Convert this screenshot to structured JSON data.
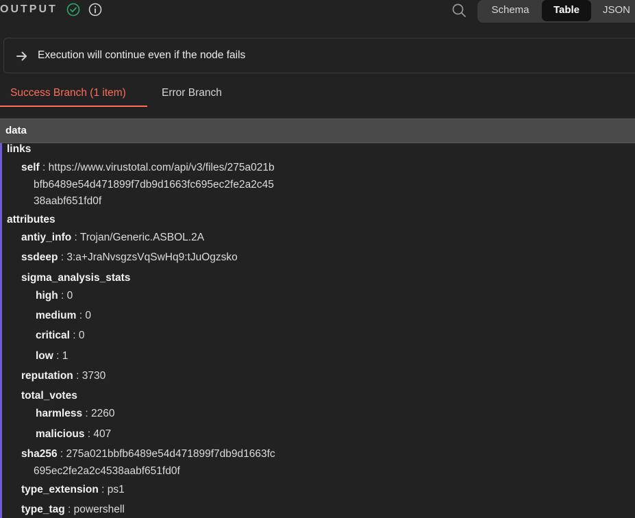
{
  "header": {
    "title": "OUTPUT",
    "views": [
      "Schema",
      "Table",
      "JSON"
    ],
    "active_view": "Table"
  },
  "notice": {
    "text": "Execution will continue even if the node fails"
  },
  "tabs": [
    "Success Branch (1 item)",
    "Error Branch"
  ],
  "table": {
    "column": "data"
  },
  "tree": {
    "links_key": "links",
    "self_key": "self",
    "self_val_1": "https://www.virustotal.com/api/v3/files/275a021b",
    "self_val_2": "bfb6489e54d471899f7db9d1663fc695ec2fe2a2c45",
    "self_val_3": "38aabf651fd0f",
    "attributes_key": "attributes",
    "antiy_info_key": "antiy_info",
    "antiy_info_val": "Trojan/Generic.ASBOL.2A",
    "ssdeep_key": "ssdeep",
    "ssdeep_val": "3:a+JraNvsgzsVqSwHq9:tJuOgzsko",
    "sigma_key": "sigma_analysis_stats",
    "high_key": "high",
    "high_val": "0",
    "medium_key": "medium",
    "medium_val": "0",
    "critical_key": "critical",
    "critical_val": "0",
    "low_key": "low",
    "low_val": "1",
    "reputation_key": "reputation",
    "reputation_val": "3730",
    "total_votes_key": "total_votes",
    "harmless_key": "harmless",
    "harmless_val": "2260",
    "malicious_key": "malicious",
    "malicious_val": "407",
    "sha256_key": "sha256",
    "sha256_val_1": "275a021bbfb6489e54d471899f7db9d1663fc",
    "sha256_val_2": "695ec2fe2a2c4538aabf651fd0f",
    "type_extension_key": "type_extension",
    "type_extension_val": "ps1",
    "type_tag_key": "type_tag",
    "type_tag_val": "powershell"
  },
  "colors": {
    "accent": "#ff6d5a",
    "success": "#2fa86a",
    "tree_bar": "#6f5cd6"
  },
  "icons": [
    "success-check-icon",
    "info-icon",
    "search-icon",
    "arrow-right-icon"
  ]
}
